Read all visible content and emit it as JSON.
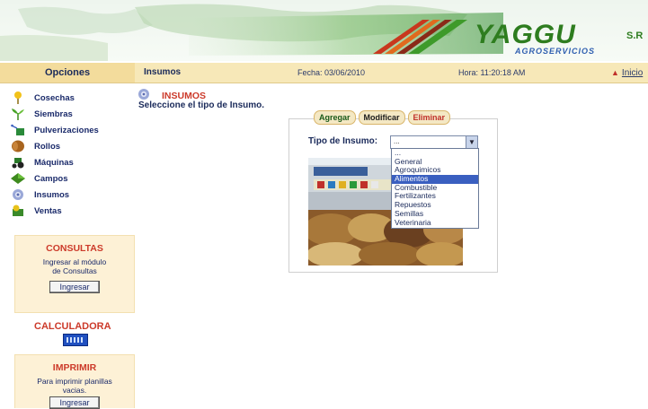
{
  "header": {
    "logo_text": "YAGGU",
    "logo_suffix": "S.R",
    "logo_sub": "AGROSERVICIOS"
  },
  "topbar": {
    "opciones": "Opciones",
    "section": "Insumos",
    "fecha": "Fecha: 03/06/2010",
    "hora": "Hora: 11:20:18 AM",
    "inicio": "Inicio"
  },
  "sidebar": {
    "items": [
      {
        "label": "Cosechas",
        "icon": "wheat-icon"
      },
      {
        "label": "Siembras",
        "icon": "sprout-icon"
      },
      {
        "label": "Pulverizaciones",
        "icon": "sprayer-icon"
      },
      {
        "label": "Rollos",
        "icon": "hay-roll-icon"
      },
      {
        "label": "Máquinas",
        "icon": "tractor-icon"
      },
      {
        "label": "Campos",
        "icon": "field-icon"
      },
      {
        "label": "Insumos",
        "icon": "supplies-icon"
      },
      {
        "label": "Ventas",
        "icon": "sales-icon"
      }
    ],
    "consultas": {
      "title": "CONSULTAS",
      "text": "Ingresar al módulo de Consultas",
      "button": "Ingresar"
    },
    "calculadora": {
      "title": "CALCULADORA"
    },
    "imprimir": {
      "title": "IMPRIMIR",
      "text": "Para imprimir planillas vacias.",
      "button": "Ingresar"
    }
  },
  "main": {
    "title": "INSUMOS",
    "subtitle": "Seleccione el tipo de Insumo.",
    "tabs": {
      "agregar": "Agregar",
      "modificar": "Modificar",
      "eliminar": "Eliminar"
    },
    "tipo_label": "Tipo de Insumo:",
    "select_value": "...",
    "options": [
      "...",
      "General",
      "Agroquimicos",
      "Alimentos",
      "Combustible",
      "Fertilizantes",
      "Repuestos",
      "Semillas",
      "Veterinaria"
    ],
    "selected_option": "Alimentos"
  },
  "colors": {
    "accent_red": "#cc3a2a",
    "topbar": "#f7e8b8",
    "brand_green": "#2e7d1f",
    "selection_blue": "#3a5fc0"
  }
}
